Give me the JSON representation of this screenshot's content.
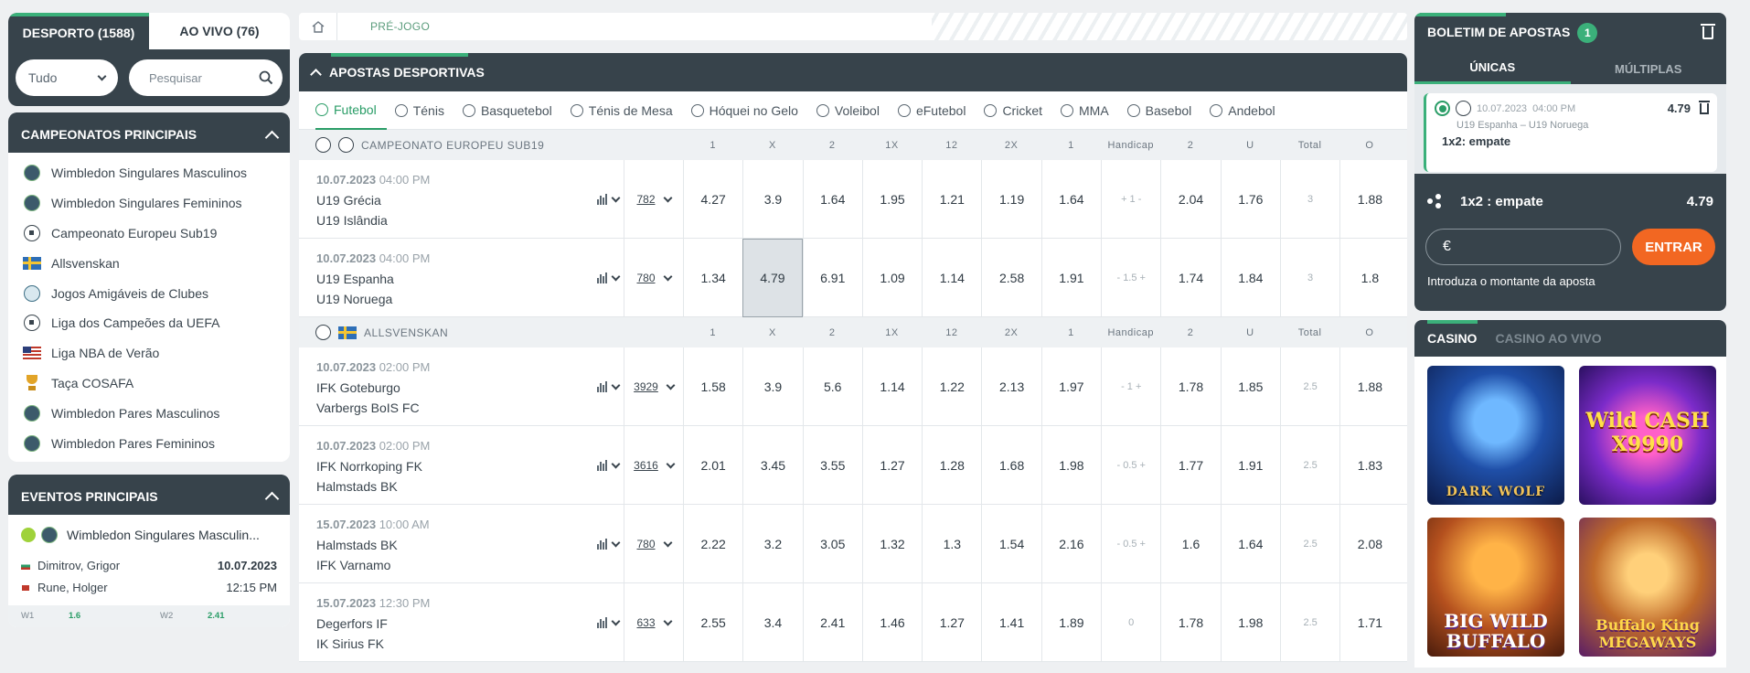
{
  "left": {
    "tabs": [
      {
        "label": "DESPORTO (1588)"
      },
      {
        "label": "AO VIVO (76)"
      }
    ],
    "filter": {
      "selected": "Tudo",
      "search_placeholder": "Pesquisar"
    },
    "championships": {
      "title": "CAMPEONATOS PRINCIPAIS",
      "items": [
        {
          "label": "Wimbledon Singulares Masculinos",
          "icon": "tennis-ball-icon"
        },
        {
          "label": "Wimbledon Singulares Femininos",
          "icon": "tennis-ball-icon"
        },
        {
          "label": "Campeonato Europeu Sub19",
          "icon": "soccer-ball-icon"
        },
        {
          "label": "Allsvenskan",
          "icon": "sweden-flag-icon"
        },
        {
          "label": "Jogos Amigáveis de Clubes",
          "icon": "globe-icon"
        },
        {
          "label": "Liga dos Campeões da UEFA",
          "icon": "soccer-ball-icon"
        },
        {
          "label": "Liga NBA de Verão",
          "icon": "usa-flag-icon"
        },
        {
          "label": "Taça COSAFA",
          "icon": "trophy-icon"
        },
        {
          "label": "Wimbledon Pares Masculinos",
          "icon": "tennis-ball-icon"
        },
        {
          "label": "Wimbledon Pares Femininos",
          "icon": "tennis-ball-icon"
        }
      ]
    },
    "events": {
      "title": "EVENTOS PRINCIPAIS",
      "event_title": "Wimbledon Singulares Masculin...",
      "player1": "Dimitrov, Grigor",
      "player2": "Rune, Holger",
      "date": "10.07.2023",
      "time": "12:15 PM",
      "w1_label": "W1",
      "w1_value": "1.6",
      "w2_label": "W2",
      "w2_value": "2.41"
    }
  },
  "main": {
    "breadcrumb": "PRÉ-JOGO",
    "section_title": "APOSTAS DESPORTIVAS",
    "sports": [
      "Futebol",
      "Ténis",
      "Basquetebol",
      "Ténis de Mesa",
      "Hóquei no Gelo",
      "Voleibol",
      "eFutebol",
      "Cricket",
      "MMA",
      "Basebol",
      "Andebol"
    ],
    "columns": [
      "1",
      "X",
      "2",
      "1X",
      "12",
      "2X",
      "1",
      "Handicap",
      "2",
      "U",
      "Total",
      "O"
    ],
    "groups": [
      {
        "name": "CAMPEONATO EUROPEU SUB19",
        "matches": [
          {
            "date": "10.07.2023",
            "time": "04:00 PM",
            "home": "U19 Grécia",
            "away": "U19 Islândia",
            "more": "782",
            "odds": [
              "4.27",
              "3.9",
              "1.64",
              "1.95",
              "1.21",
              "1.19",
              "1.64",
              "+ 1 -",
              "2.04",
              "1.76",
              "3",
              "1.88"
            ]
          },
          {
            "date": "10.07.2023",
            "time": "04:00 PM",
            "home": "U19 Espanha",
            "away": "U19 Noruega",
            "more": "780",
            "odds": [
              "1.34",
              "4.79",
              "6.91",
              "1.09",
              "1.14",
              "2.58",
              "1.91",
              "- 1.5 +",
              "1.74",
              "1.84",
              "3",
              "1.8"
            ]
          }
        ]
      },
      {
        "name": "ALLSVENSKAN",
        "matches": [
          {
            "date": "10.07.2023",
            "time": "02:00 PM",
            "home": "IFK Goteburgo",
            "away": "Varbergs BoIS FC",
            "more": "3929",
            "odds": [
              "1.58",
              "3.9",
              "5.6",
              "1.14",
              "1.22",
              "2.13",
              "1.97",
              "- 1 +",
              "1.78",
              "1.85",
              "2.5",
              "1.88"
            ]
          },
          {
            "date": "10.07.2023",
            "time": "02:00 PM",
            "home": "IFK Norrkoping FK",
            "away": "Halmstads BK",
            "more": "3616",
            "odds": [
              "2.01",
              "3.45",
              "3.55",
              "1.27",
              "1.28",
              "1.68",
              "1.98",
              "- 0.5 +",
              "1.77",
              "1.91",
              "2.5",
              "1.83"
            ]
          },
          {
            "date": "15.07.2023",
            "time": "10:00 AM",
            "home": "Halmstads BK",
            "away": "IFK Varnamo",
            "more": "780",
            "odds": [
              "2.22",
              "3.2",
              "3.05",
              "1.32",
              "1.3",
              "1.54",
              "2.16",
              "- 0.5 +",
              "1.6",
              "1.64",
              "2.5",
              "2.08"
            ]
          },
          {
            "date": "15.07.2023",
            "time": "12:30 PM",
            "home": "Degerfors IF",
            "away": "IK Sirius FK",
            "more": "633",
            "odds": [
              "2.55",
              "3.4",
              "2.41",
              "1.46",
              "1.27",
              "1.41",
              "1.89",
              "0",
              "1.78",
              "1.98",
              "2.5",
              "1.71"
            ]
          }
        ]
      }
    ]
  },
  "slip": {
    "title": "BOLETIM DE APOSTAS",
    "count": "1",
    "tabs": [
      "ÚNICAS",
      "MÚLTIPLAS"
    ],
    "bet": {
      "date": "10.07.2023",
      "time": "04:00 PM",
      "odd": "4.79",
      "teams": "U19 Espanha – U19 Noruega",
      "pick": "1x2: empate"
    },
    "summary_label": "1x2 : empate",
    "summary_odd": "4.79",
    "currency": "€",
    "enter": "ENTRAR",
    "hint": "Introduza o montante da aposta"
  },
  "casino": {
    "tabs": [
      "CASINO",
      "CASINO AO VIVO"
    ],
    "games": [
      {
        "name": "DARK WOLF"
      },
      {
        "name": "Wild CASH X9990"
      },
      {
        "name": "BIG WILD BUFFALO"
      },
      {
        "name": "Buffalo King MEGAWAYS"
      }
    ]
  },
  "colors": {
    "accent": "#3bb07a",
    "dark": "#37434b",
    "cta": "#f26722"
  }
}
